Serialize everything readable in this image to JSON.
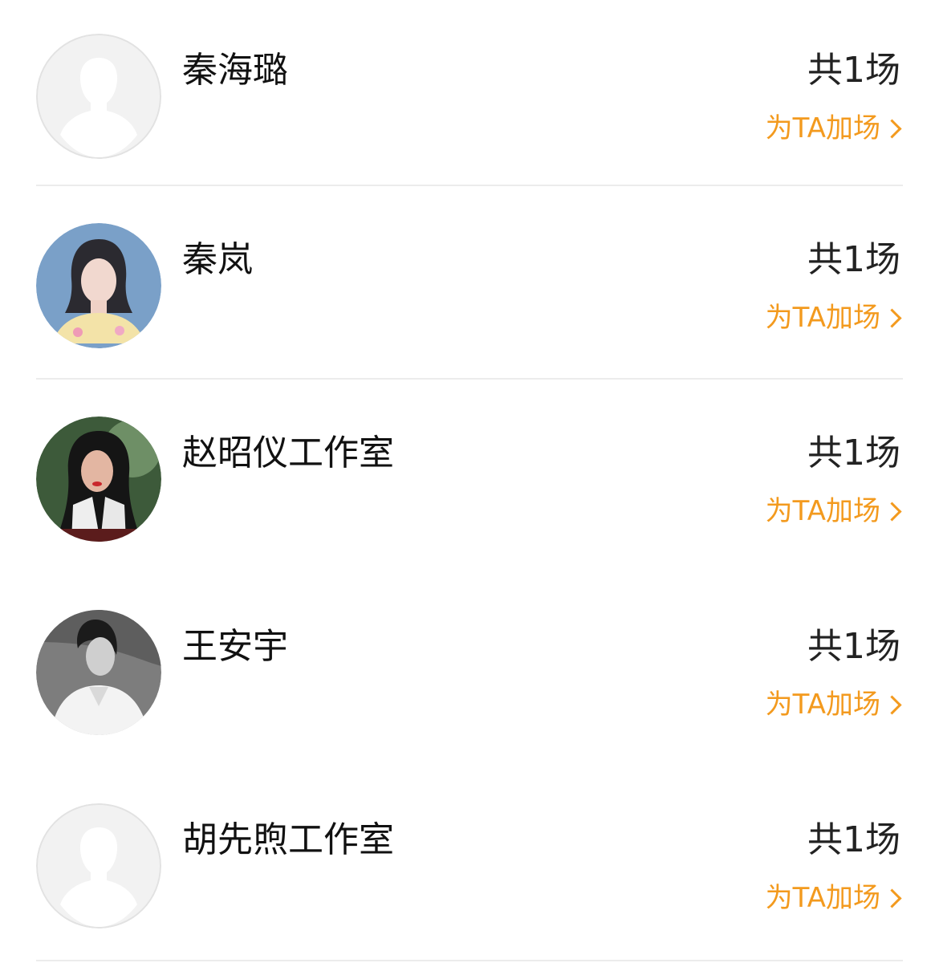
{
  "colors": {
    "accent": "#f39a1e",
    "divider": "#ececec",
    "name_text": "#111111"
  },
  "items": [
    {
      "name": "秦海璐",
      "count": "共1场",
      "action": "为TA加场",
      "avatar": "placeholder-avatar-icon"
    },
    {
      "name": "秦岚",
      "count": "共1场",
      "action": "为TA加场",
      "avatar": "photo-avatar"
    },
    {
      "name": "赵昭仪工作室",
      "count": "共1场",
      "action": "为TA加场",
      "avatar": "photo-avatar"
    },
    {
      "name": "王安宇",
      "count": "共1场",
      "action": "为TA加场",
      "avatar": "photo-avatar"
    },
    {
      "name": "胡先煦工作室",
      "count": "共1场",
      "action": "为TA加场",
      "avatar": "placeholder-avatar-icon"
    }
  ]
}
